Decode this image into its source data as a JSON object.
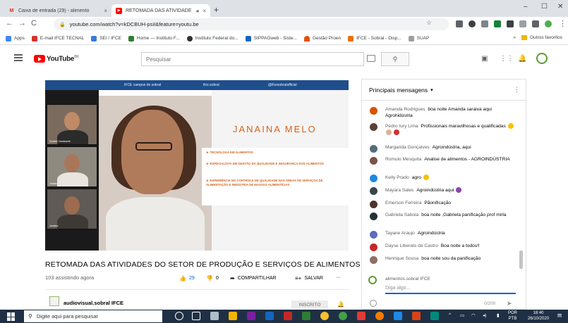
{
  "browser": {
    "tabs": [
      {
        "label": "Caixa de entrada (29) - alimento",
        "close": "×",
        "icon": "gmail-icon",
        "color": "#d93025"
      },
      {
        "label": "RETOMADA DAS ATIVIDADE",
        "close": "×",
        "icon": "youtube-icon",
        "color": "#ff0000"
      }
    ],
    "new_tab": "+",
    "window_controls": [
      "–",
      "☐",
      "✕"
    ],
    "url": "youtube.com/watch?v=kDCBUH-psiI&feature=youtu.be",
    "bookmarks": [
      {
        "label": "Apps",
        "color": "#4285f4"
      },
      {
        "label": "E-mail IFCE TECNAL",
        "color": "#d93025"
      },
      {
        "label": "SEI / IFCE",
        "color": "#3a7bd5"
      },
      {
        "label": "Home — Instituto F...",
        "color": "#2e7d32"
      },
      {
        "label": "Instituto Federal do...",
        "color": "#333333"
      },
      {
        "label": "SIPPAGweb - Siste...",
        "color": "#1565c0"
      },
      {
        "label": "Gestão Proen",
        "color": "#e65100"
      },
      {
        "label": "IFCE - Sobral - Disp...",
        "color": "#ef6c00"
      },
      {
        "label": "SUAP",
        "color": "#9e9e9e"
      }
    ],
    "bookmarks_overflow": "»",
    "other_bookmarks": "Outros favoritos"
  },
  "youtube": {
    "logo_text": "YouTube",
    "region": "BR",
    "search_placeholder": "Pesquisar"
  },
  "video": {
    "overlay_handles": [
      "IFCE campus de sobral",
      "ifce.sobral",
      "@ifcesobralofficial"
    ],
    "speaker_name": "JANAINA MELO",
    "bullets": [
      "TECNÓLOGA EM ALIMENTOS",
      "ESPECIALISTA EM GESTÃO DA QUALIDADE E SEGURANÇA DOS ALIMENTOS",
      "EXPERIÊNCIA NO CONTROLE DE QUALIDADE NAS ÁREAS DE SERVIÇOS DE ALIMENTAÇÃO E INDÚSTRIA DE MASSAS ALIMENTÍCIAS"
    ],
    "participants": [
      "Zinaldo Cavalcante",
      "Janaina",
      "Janaina"
    ],
    "title": "RETOMADA DAS ATIVIDADES DO SETOR DE PRODUÇÃO E SERVIÇOS DE ALIMENTOS",
    "watching": "103 assistindo agora",
    "likes": "29",
    "dislikes": "0",
    "share": "COMPARTILHAR",
    "save": "SALVAR",
    "more": "···",
    "channel": "audiovisual.sobral IFCE",
    "subscribe": "INSCRITO"
  },
  "chat": {
    "header": "Principais mensagens",
    "messages": [
      {
        "author": "Amanda Rodrigues",
        "text": "boa noite Amanda saraiva aqui Agrohidústria",
        "avatar": "#d35400"
      },
      {
        "author": "Pedro Iury Lima",
        "text": "Profissionais maravilhosas e qualificadas",
        "avatar": "#5d4037"
      },
      {
        "author": "Margarida Gonçalves",
        "text": "Agroindústria, aqui",
        "avatar": "#546e7a"
      },
      {
        "author": "Romulo Mesquita",
        "text": "Analise de alimentos - AGROINDÚSTRIA",
        "avatar": "#795548"
      },
      {
        "author": "Kelly Prado",
        "text": "agro",
        "avatar": "#1e88e5"
      },
      {
        "author": "Mayara Sales",
        "text": "Agroindústria aqui",
        "avatar": "#37474f"
      },
      {
        "author": "Emerson Ferreira",
        "text": "Pãonificação",
        "avatar": "#4e342e"
      },
      {
        "author": "Gabriela Saboia",
        "text": "boa noite ,Gabriela panificação prof mirla",
        "avatar": "#263238"
      },
      {
        "author": "Tayane Araujo",
        "text": "Agroindústria",
        "avatar": "#5c6bc0"
      },
      {
        "author": "Dayse Liberato de Castro",
        "text": "Boa noite a todos!!",
        "avatar": "#c62828"
      },
      {
        "author": "Henrique Sousa",
        "text": "boa noite sou da panificação",
        "avatar": "#8d6e63"
      }
    ],
    "current_user": "alimentos.sobral IFCE",
    "input_placeholder": "Diga algo...",
    "char_count": "0/200"
  },
  "taskbar": {
    "search_placeholder": "Digite aqui para pesquisar",
    "language": "POR",
    "layout": "PTB",
    "time": "18:40",
    "date": "26/10/2020"
  }
}
